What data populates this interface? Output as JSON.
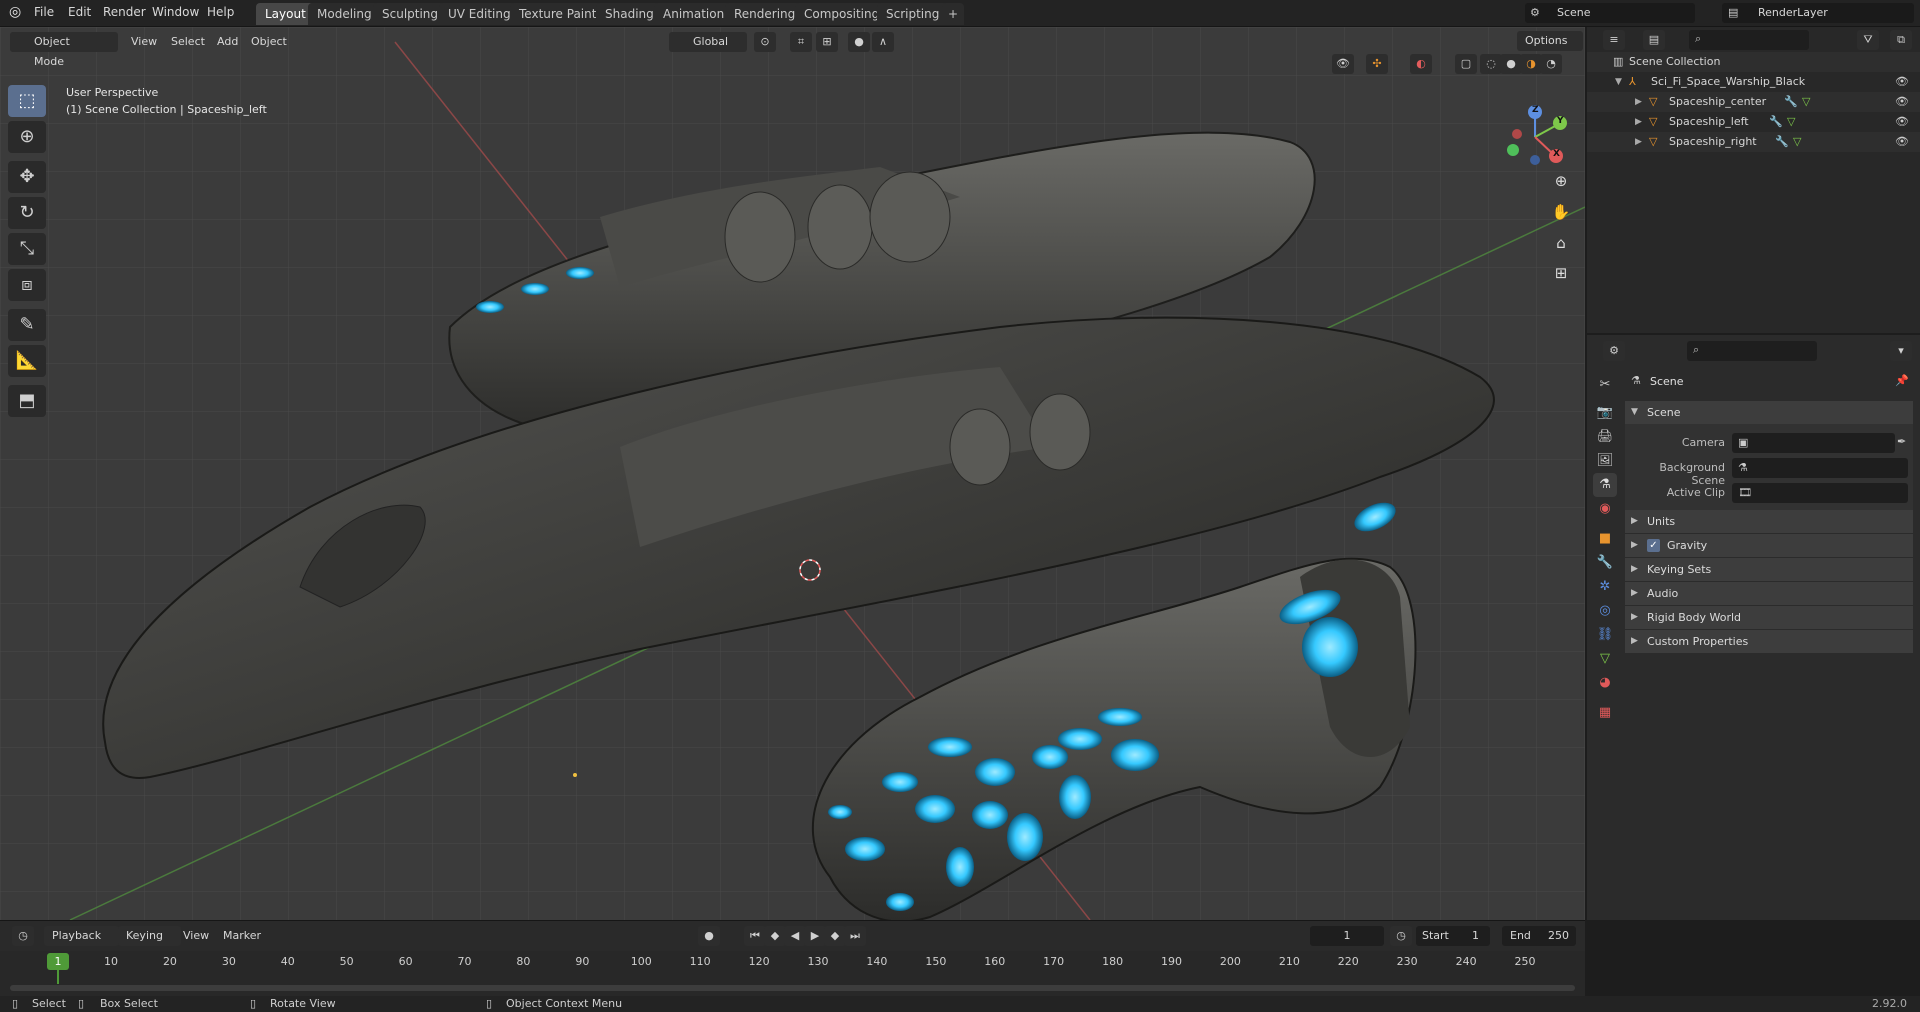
{
  "app": {
    "menu": [
      "File",
      "Edit",
      "Render",
      "Window",
      "Help"
    ],
    "workspaces": [
      "Layout",
      "Modeling",
      "Sculpting",
      "UV Editing",
      "Texture Paint",
      "Shading",
      "Animation",
      "Rendering",
      "Compositing",
      "Scripting"
    ],
    "active_workspace": "Layout",
    "add_tab_symbol": "+",
    "scene_field": "Scene",
    "view_layer_field": "RenderLayer",
    "version": "2.92.0"
  },
  "viewport": {
    "mode": "Object Mode",
    "menus": [
      "View",
      "Select",
      "Add",
      "Object"
    ],
    "transform_orientation": "Global",
    "options_label": "Options",
    "perspective_label": "User Perspective",
    "context_label": "(1) Scene Collection | Spaceship_left",
    "gizmo_axes": {
      "x": "X",
      "y": "Y",
      "z": "Z"
    },
    "axis_colors": {
      "x": "#e05a5a",
      "y": "#7ec84a",
      "z": "#5d8fe0"
    }
  },
  "outliner": {
    "search_placeholder": "",
    "root": "Scene Collection",
    "collection": "Sci_Fi_Space_Warship_Black",
    "objects": [
      "Spaceship_center",
      "Spaceship_left",
      "Spaceship_right"
    ]
  },
  "properties": {
    "search_placeholder": "",
    "context_title": "Scene",
    "panel_scene": "Scene",
    "fields": [
      {
        "label": "Camera",
        "value": ""
      },
      {
        "label": "Background Scene",
        "value": ""
      },
      {
        "label": "Active Clip",
        "value": ""
      }
    ],
    "collapsed_panels": [
      "Units",
      "Gravity",
      "Keying Sets",
      "Audio",
      "Rigid Body World",
      "Custom Properties"
    ],
    "gravity_enabled": true
  },
  "timeline": {
    "menus": [
      "Playback",
      "Keying",
      "View",
      "Marker"
    ],
    "current_frame": "1",
    "start_label": "Start",
    "start_value": "1",
    "end_label": "End",
    "end_value": "250",
    "ticks": [
      "1",
      "10",
      "20",
      "30",
      "40",
      "50",
      "60",
      "70",
      "80",
      "90",
      "100",
      "110",
      "120",
      "130",
      "140",
      "150",
      "160",
      "170",
      "180",
      "190",
      "200",
      "210",
      "220",
      "230",
      "240",
      "250"
    ]
  },
  "statusbar": {
    "items": [
      "Select",
      "Box Select",
      "Rotate View",
      "Object Context Menu"
    ]
  },
  "colors": {
    "accent": "#5b6f8f",
    "glow": "#35c9ff",
    "object_icon": "#e8942e"
  }
}
